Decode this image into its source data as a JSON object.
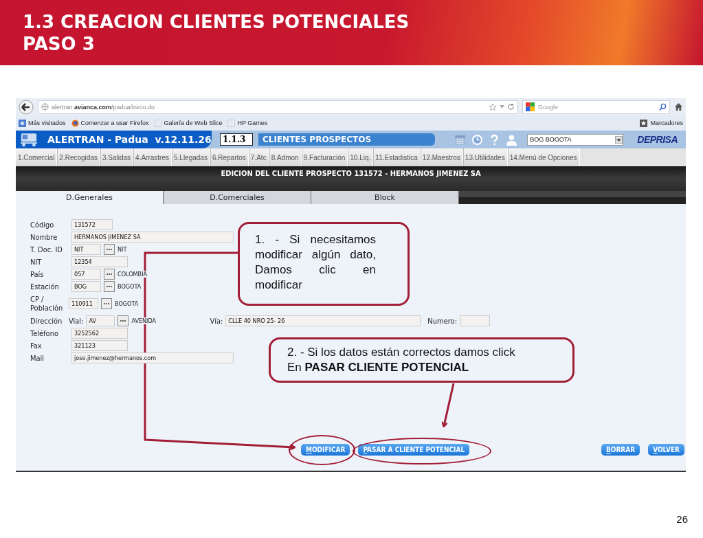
{
  "slide": {
    "title_lines": [
      "1.3 CREACION CLIENTES POTENCIALES",
      "PASO 3"
    ],
    "page_number": "26"
  },
  "browser": {
    "url": "alertran.**avianca.com**/padua/inicio.do",
    "search_placeholder": "Google",
    "bookmarks": [
      {
        "label": "Más visitados",
        "kind": "feed"
      },
      {
        "label": "Comenzar a usar Firefox",
        "kind": "firefox"
      },
      {
        "label": "Galería de Web Slice",
        "kind": "slice"
      },
      {
        "label": "HP Games",
        "kind": "slice"
      }
    ],
    "bookmarks_menu": "Marcadores"
  },
  "app": {
    "title": "ALERTRAN - Padua  v.12.11.26",
    "screen_code": "1.1.3",
    "screen_name": "CLIENTES PROSPECTOS",
    "station": "BOG BOGOTA",
    "logo": "DEPRISA",
    "menu": [
      "1.Comercial",
      "2.Recogidas",
      "3.Salidas",
      "4.Arrastres",
      "5.Llegadas",
      "6.Repartos",
      "7.Atc",
      "8.Admon",
      "9.Facturación",
      "10.Liq.",
      "11.Estadistica",
      "12.Maestros",
      "13.Utilidades",
      "14.Menú de Opciones"
    ],
    "banner": "EDICION DEL CLIENTE PROSPECTO 131572 - HERMANOS JIMENEZ SA",
    "tabs": [
      {
        "label": "D.Generales",
        "selected": true
      },
      {
        "label": "D.Comerciales",
        "selected": false
      },
      {
        "label": "Block",
        "selected": false
      }
    ],
    "fields": [
      {
        "kind": "short",
        "label": "Código",
        "value": "131572"
      },
      {
        "kind": "long",
        "label": "Nombre",
        "value": "HERMANOS JIMENEZ SA"
      },
      {
        "kind": "lookup",
        "label": "T. Doc. ID",
        "value": "NIT",
        "description": "NIT"
      },
      {
        "kind": "medium",
        "label": "NIT",
        "value": "12354"
      },
      {
        "kind": "lookup",
        "label": "País",
        "value": "057",
        "description": "COLOMBIA"
      },
      {
        "kind": "lookup",
        "label": "Estación",
        "value": "BOG",
        "description": "BOGOTA"
      },
      {
        "kind": "lookup",
        "label": "CP / Población",
        "value": "110911",
        "description": "BOGOTA"
      },
      {
        "kind": "address",
        "label": "Dirección",
        "vial_label": "Vial:",
        "value": "AV",
        "description": "AVENIDA",
        "via_label": "Vía:",
        "via_value": "CLLE 40  NRO 25- 26",
        "number_label": "Numero:"
      },
      {
        "kind": "medium",
        "label": "Teléfono",
        "value": "3252562"
      },
      {
        "kind": "medium",
        "label": "Fax",
        "value": "321123"
      },
      {
        "kind": "long",
        "label": "Mail",
        "value": "jose.jimenez@hermanos.com"
      }
    ],
    "buttons": [
      {
        "label": "MODIFICAR",
        "highlighted": true
      },
      {
        "label": "PASAR A CLIENTE POTENCIAL",
        "highlighted": true
      },
      {
        "label": "BORRAR",
        "highlighted": false
      },
      {
        "label": "VOLVER",
        "highlighted": false
      }
    ]
  },
  "callouts": [
    {
      "text": "1. - Si necesitamos modificar algún dato, Damos clic en modificar"
    },
    {
      "text": "2. - Si los datos están correctos damos click En **PASAR CLIENTE POTENCIAL**"
    }
  ]
}
